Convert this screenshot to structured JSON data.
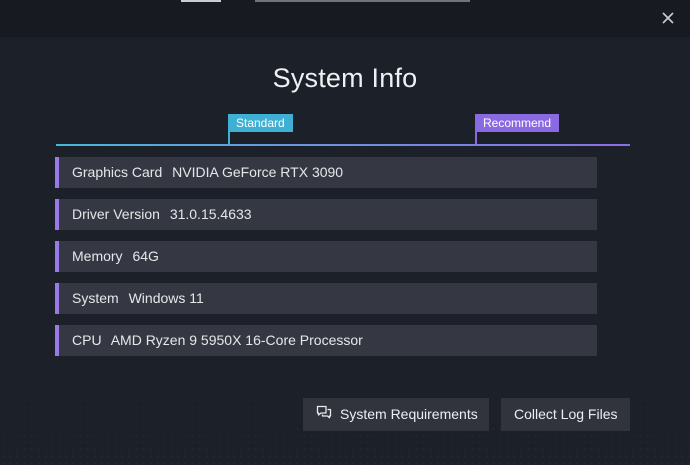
{
  "dialog": {
    "title": "System Info",
    "close_icon": "close-icon"
  },
  "scale": {
    "standard_label": "Standard",
    "recommend_label": "Recommend",
    "colors": {
      "standard": "#3fb0d4",
      "recommend": "#8a6ae0"
    }
  },
  "info_rows": [
    {
      "label": "Graphics Card",
      "value": "NVIDIA GeForce RTX 3090"
    },
    {
      "label": "Driver Version",
      "value": "31.0.15.4633"
    },
    {
      "label": "Memory",
      "value": "64G"
    },
    {
      "label": "System",
      "value": "Windows 11"
    },
    {
      "label": "CPU",
      "value": "AMD Ryzen 9 5950X 16-Core Processor"
    }
  ],
  "buttons": {
    "system_requirements": {
      "label": "System Requirements",
      "icon": "chat-icon"
    },
    "collect_logs": {
      "label": "Collect Log Files"
    }
  }
}
